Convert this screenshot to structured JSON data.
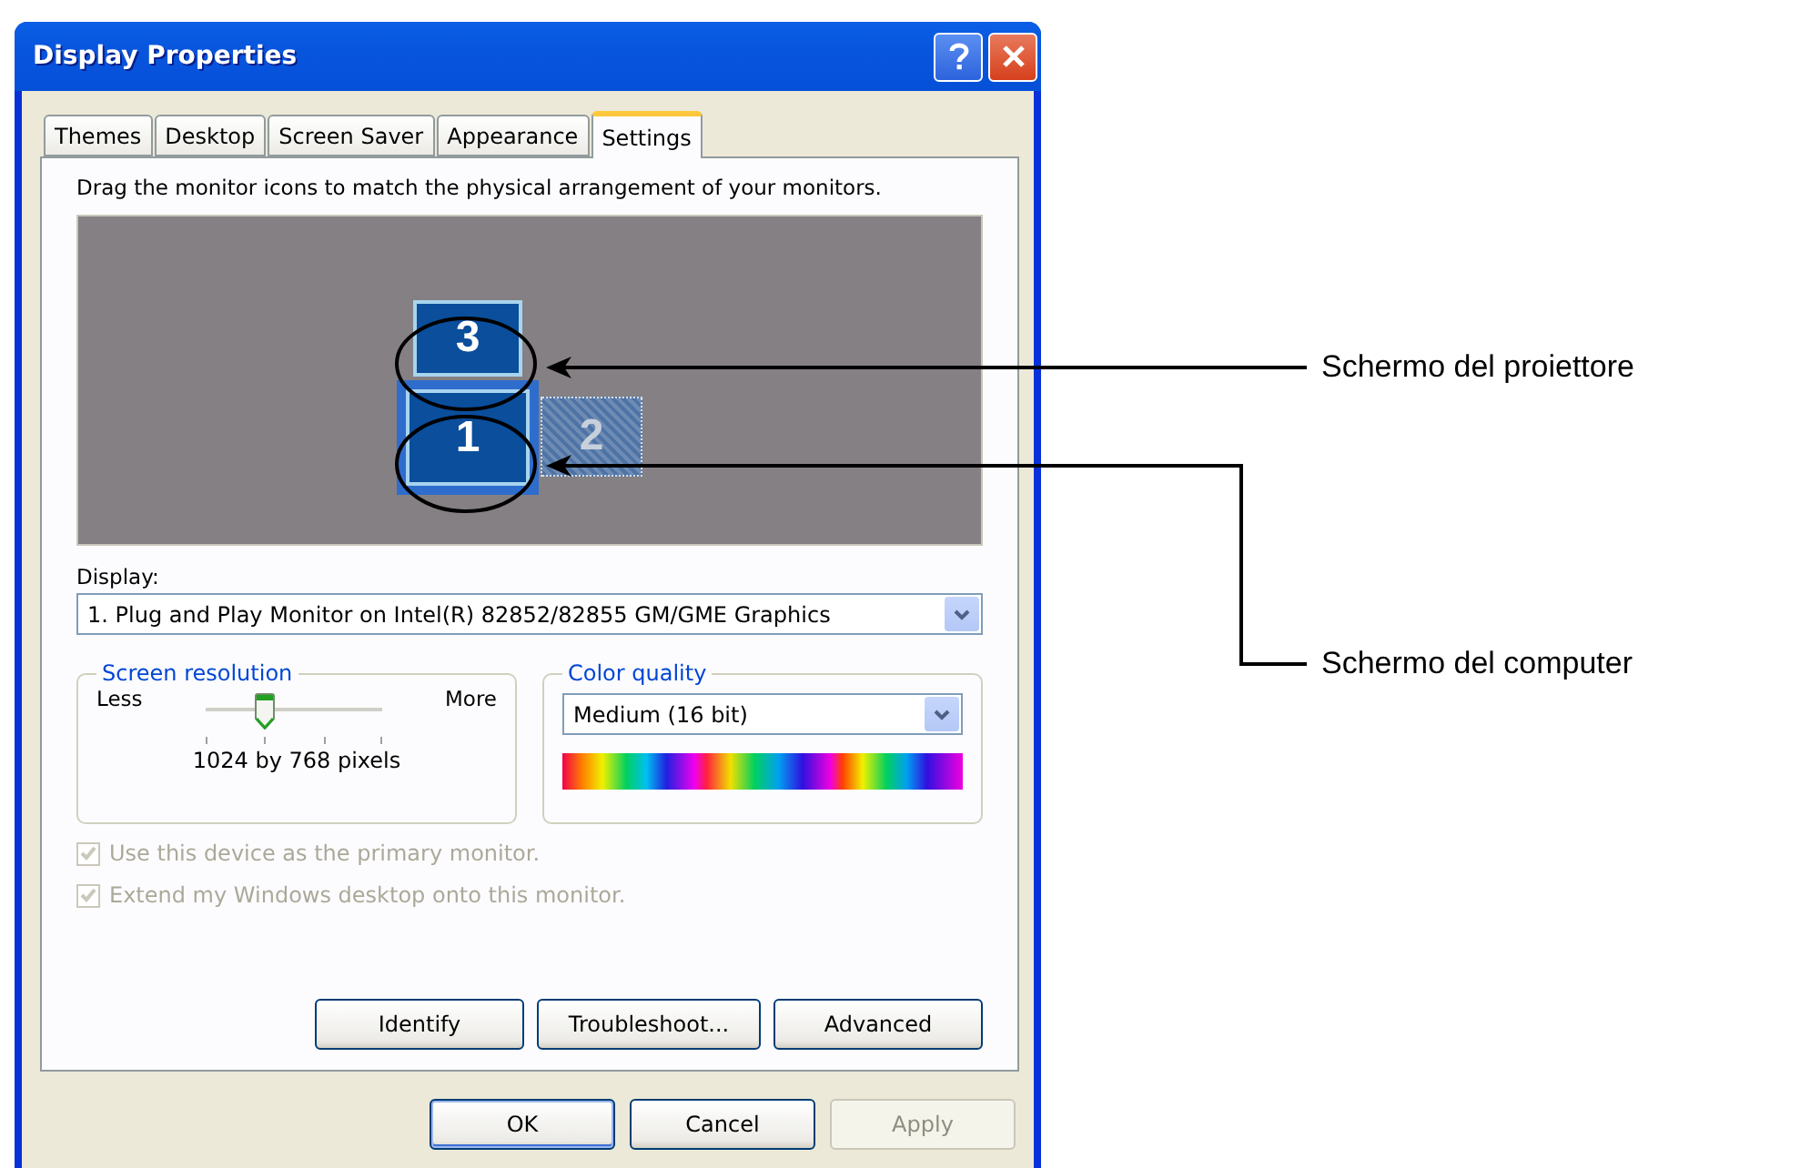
{
  "window": {
    "title": "Display Properties"
  },
  "tabs": [
    {
      "label": "Themes",
      "selected": false
    },
    {
      "label": "Desktop",
      "selected": false
    },
    {
      "label": "Screen Saver",
      "selected": false
    },
    {
      "label": "Appearance",
      "selected": false
    },
    {
      "label": "Settings",
      "selected": true
    }
  ],
  "instruction": "Drag the monitor icons to match the physical arrangement of your monitors.",
  "monitors": [
    {
      "number": "3",
      "kind": "attached",
      "selected": false
    },
    {
      "number": "1",
      "kind": "attached",
      "selected": true
    },
    {
      "number": "2",
      "kind": "detached",
      "selected": false
    }
  ],
  "display": {
    "label": "Display:",
    "value": "1. Plug and Play Monitor on Intel(R) 82852/82855 GM/GME Graphics"
  },
  "resolution": {
    "title": "Screen resolution",
    "less": "Less",
    "more": "More",
    "level": 0.333,
    "reading": "1024 by 768 pixels"
  },
  "color_quality": {
    "title": "Color quality",
    "value": "Medium (16 bit)"
  },
  "checkboxes": [
    {
      "label": "Use this device as the primary monitor.",
      "checked": true,
      "disabled": true
    },
    {
      "label": "Extend my Windows desktop onto this monitor.",
      "checked": true,
      "disabled": true
    }
  ],
  "panel_buttons": [
    "Identify",
    "Troubleshoot...",
    "Advanced"
  ],
  "footer_buttons": [
    {
      "label": "OK",
      "disabled": false,
      "default": true
    },
    {
      "label": "Cancel",
      "disabled": false,
      "default": false
    },
    {
      "label": "Apply",
      "disabled": true,
      "default": false
    }
  ],
  "annotations": [
    {
      "label": "Schermo del proiettore"
    },
    {
      "label": "Schermo del computer"
    }
  ]
}
